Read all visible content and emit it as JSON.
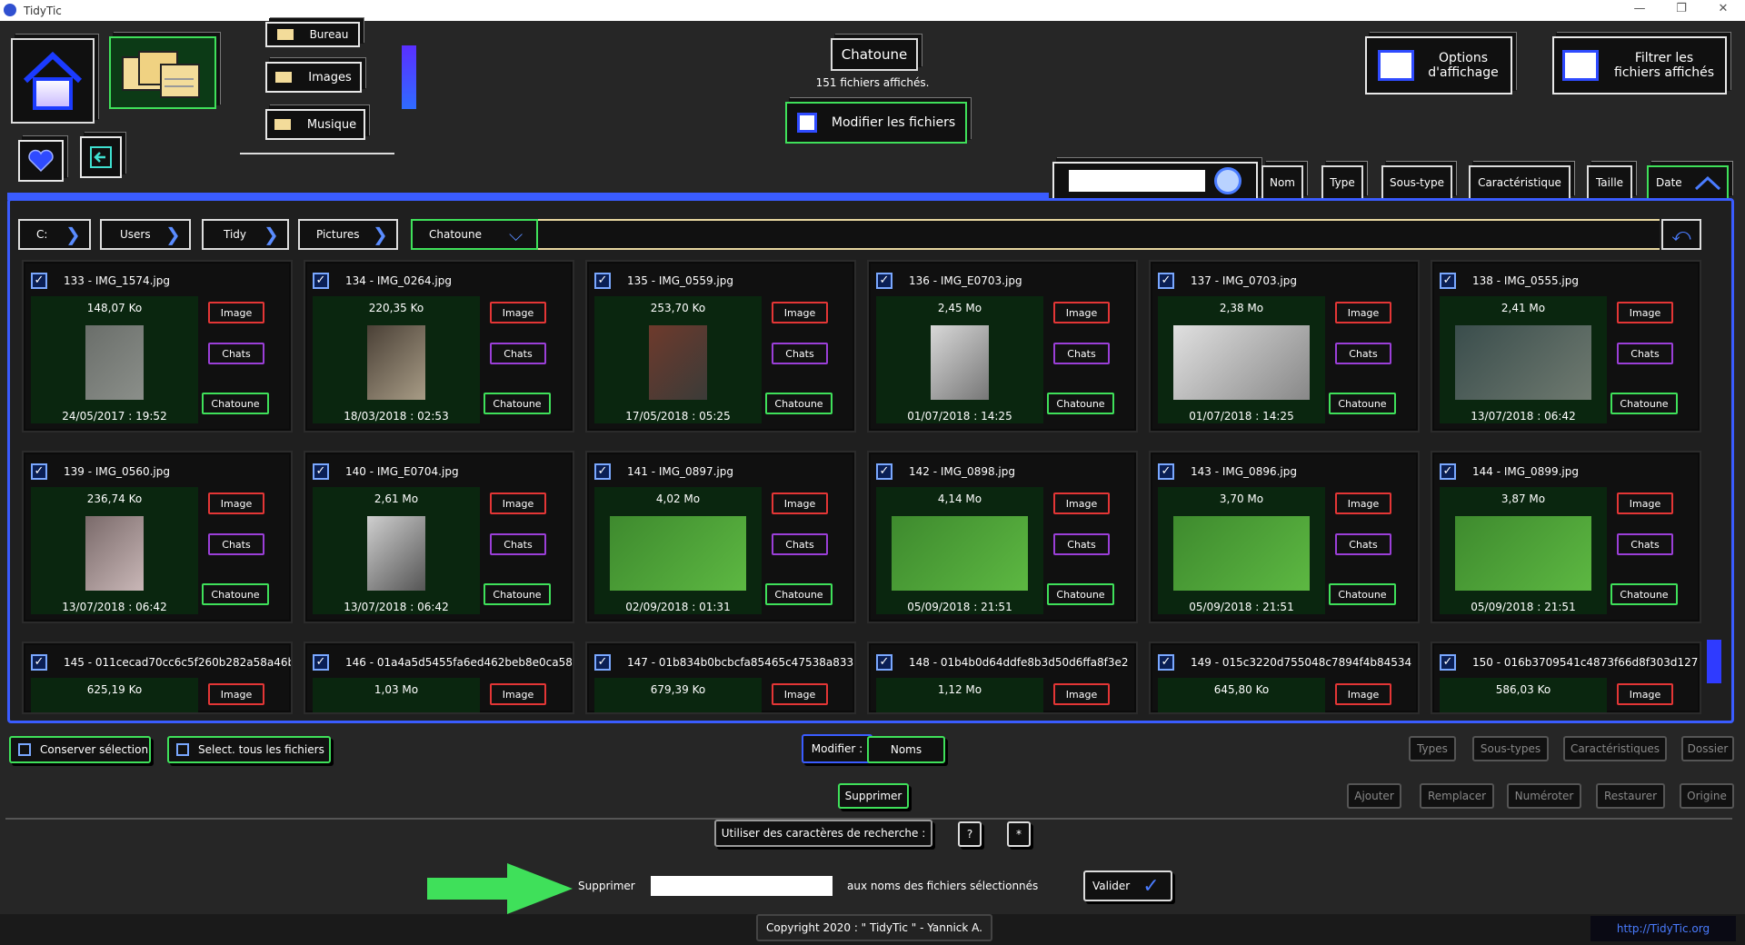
{
  "window": {
    "title": "TidyTic",
    "minimize": "—",
    "maximize": "❐",
    "close": "✕"
  },
  "folders": {
    "items": [
      "Bureau",
      "Images",
      "Musique"
    ]
  },
  "current_folder": {
    "name": "Chatoune",
    "count_text": "151 fichiers affichés."
  },
  "modify_files_label": "Modifier les fichiers",
  "options_label": "Options d'affichage",
  "filter_label": "Filtrer les fichiers affichés",
  "search": {
    "value": ""
  },
  "sort": {
    "nom": "Nom",
    "type": "Type",
    "soustype": "Sous-type",
    "caracteristique": "Caractéristique",
    "taille": "Taille",
    "date": "Date"
  },
  "breadcrumb": [
    "C:",
    "Users",
    "Tidy",
    "Pictures",
    "Chatoune"
  ],
  "files": [
    {
      "name": "133 - IMG_1574.jpg",
      "size": "148,07 Ko",
      "date": "24/05/2017 : 19:52",
      "tag1": "Image",
      "tag2": "Chats",
      "tag3": "Chatoune"
    },
    {
      "name": "134 - IMG_0264.jpg",
      "size": "220,35 Ko",
      "date": "18/03/2018 : 02:53",
      "tag1": "Image",
      "tag2": "Chats",
      "tag3": "Chatoune"
    },
    {
      "name": "135 - IMG_0559.jpg",
      "size": "253,70 Ko",
      "date": "17/05/2018 : 05:25",
      "tag1": "Image",
      "tag2": "Chats",
      "tag3": "Chatoune"
    },
    {
      "name": "136 - IMG_E0703.jpg",
      "size": "2,45 Mo",
      "date": "01/07/2018 : 14:25",
      "tag1": "Image",
      "tag2": "Chats",
      "tag3": "Chatoune"
    },
    {
      "name": "137 - IMG_0703.jpg",
      "size": "2,38 Mo",
      "date": "01/07/2018 : 14:25",
      "tag1": "Image",
      "tag2": "Chats",
      "tag3": "Chatoune"
    },
    {
      "name": "138 - IMG_0555.jpg",
      "size": "2,41 Mo",
      "date": "13/07/2018 : 06:42",
      "tag1": "Image",
      "tag2": "Chats",
      "tag3": "Chatoune"
    },
    {
      "name": "139 - IMG_0560.jpg",
      "size": "236,74 Ko",
      "date": "13/07/2018 : 06:42",
      "tag1": "Image",
      "tag2": "Chats",
      "tag3": "Chatoune"
    },
    {
      "name": "140 - IMG_E0704.jpg",
      "size": "2,61 Mo",
      "date": "13/07/2018 : 06:42",
      "tag1": "Image",
      "tag2": "Chats",
      "tag3": "Chatoune"
    },
    {
      "name": "141 - IMG_0897.jpg",
      "size": "4,02 Mo",
      "date": "02/09/2018 : 01:31",
      "tag1": "Image",
      "tag2": "Chats",
      "tag3": "Chatoune"
    },
    {
      "name": "142 - IMG_0898.jpg",
      "size": "4,14 Mo",
      "date": "05/09/2018 : 21:51",
      "tag1": "Image",
      "tag2": "Chats",
      "tag3": "Chatoune"
    },
    {
      "name": "143 - IMG_0896.jpg",
      "size": "3,70 Mo",
      "date": "05/09/2018 : 21:51",
      "tag1": "Image",
      "tag2": "Chats",
      "tag3": "Chatoune"
    },
    {
      "name": "144 - IMG_0899.jpg",
      "size": "3,87 Mo",
      "date": "05/09/2018 : 21:51",
      "tag1": "Image",
      "tag2": "Chats",
      "tag3": "Chatoune"
    },
    {
      "name": "145 - 011cecad70cc6c5f260b282a58a46b",
      "size": "625,19 Ko",
      "date": "",
      "tag1": "Image",
      "tag2": "",
      "tag3": ""
    },
    {
      "name": "146 - 01a4a5d5455fa6ed462beb8e0ca58",
      "size": "1,03 Mo",
      "date": "",
      "tag1": "Image",
      "tag2": "",
      "tag3": ""
    },
    {
      "name": "147 - 01b834b0bcbcfa85465c47538a833",
      "size": "679,39 Ko",
      "date": "",
      "tag1": "Image",
      "tag2": "",
      "tag3": ""
    },
    {
      "name": "148 - 01b4b0d64ddfe8b3d50d6ffa8f3e2",
      "size": "1,12 Mo",
      "date": "",
      "tag1": "Image",
      "tag2": "",
      "tag3": ""
    },
    {
      "name": "149 - 015c3220d755048c7894f4b84534",
      "size": "645,80 Ko",
      "date": "",
      "tag1": "Image",
      "tag2": "",
      "tag3": ""
    },
    {
      "name": "150 - 016b3709541c4873f66d8f303d127",
      "size": "586,03 Ko",
      "date": "",
      "tag1": "Image",
      "tag2": "",
      "tag3": ""
    }
  ],
  "bottom": {
    "keep_selection": "Conserver sélection",
    "select_all": "Select. tous les fichiers",
    "modify": "Modifier :",
    "names": "Noms",
    "types": "Types",
    "subtypes": "Sous-types",
    "characteristics": "Caractéristiques",
    "folder": "Dossier",
    "delete": "Supprimer",
    "add": "Ajouter",
    "replace": "Remplacer",
    "number": "Numéroter",
    "restore": "Restaurer",
    "origin": "Origine",
    "wildcards": "Utiliser des caractères de recherche :",
    "wild_q": "?",
    "wild_star": "*",
    "delete_label": "Supprimer",
    "delete_value": "",
    "names_suffix": "aux noms des fichiers sélectionnés",
    "validate": "Valider",
    "check": "✓"
  },
  "footer": {
    "copyright": "Copyright 2020 : \" TidyTic \" - Yannick A.",
    "url": "http://TidyTic.org"
  },
  "colors": {
    "accent": "#3a5cff",
    "green": "#3fe05a",
    "red": "#e43636",
    "purple": "#9b3fd8"
  }
}
